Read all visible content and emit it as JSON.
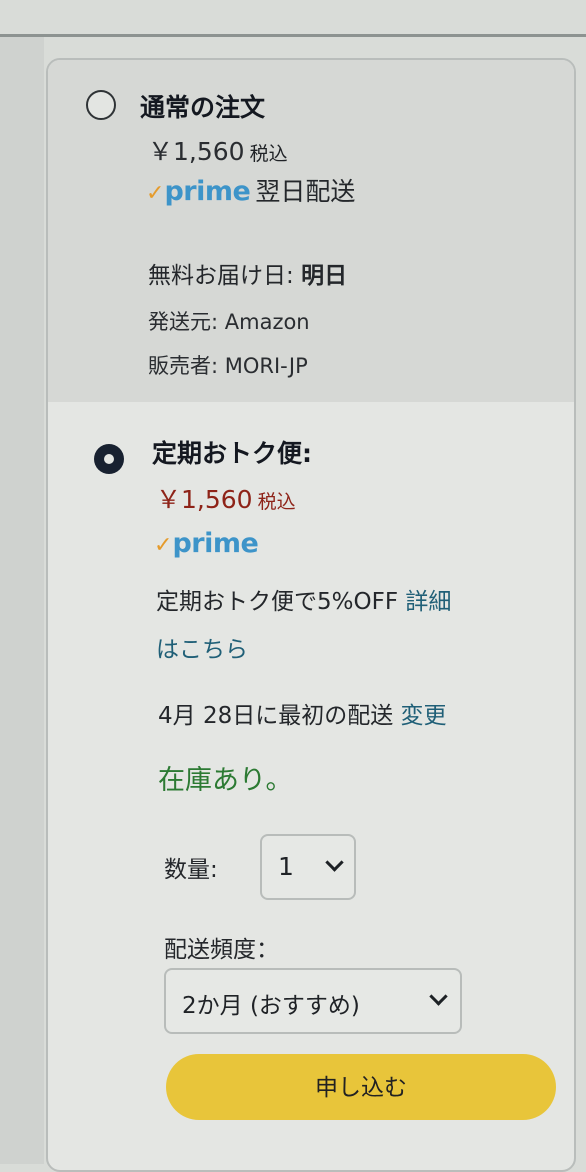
{
  "options": {
    "normal": {
      "title": "通常の注文",
      "price": "￥1,560",
      "tax_label": "税込",
      "prime_check": "✓",
      "prime_label": "prime",
      "delivery_type": "翌日配送",
      "free_delivery_label": "無料お届け日:",
      "free_delivery_value": "明日",
      "ships_from": "発送元: Amazon",
      "seller": "販売者: MORI-JP"
    },
    "subscribe": {
      "title": "定期おトク便:",
      "price": "￥1,560",
      "tax_label": "税込",
      "prime_check": "✓",
      "prime_label": "prime",
      "discount_text": "定期おトク便で5%OFF",
      "details_link_part1": "詳細",
      "details_link_part2": "はこちら",
      "first_delivery_text": "4月 28日に最初の配送",
      "change_link": "変更",
      "stock_status": "在庫あり。",
      "quantity_label": "数量:",
      "quantity_value": "1",
      "frequency_label": "配送頻度：",
      "frequency_value": "2か月 (おすすめ)",
      "submit_label": "申し込む"
    }
  },
  "colors": {
    "price_red": "#8e2318",
    "prime_blue": "#3d94c9",
    "prime_check_orange": "#e59b2c",
    "stock_green": "#2c7a33",
    "link_teal": "#1f5f77",
    "button_yellow": "#e8c53a"
  },
  "selected_option": "subscribe"
}
